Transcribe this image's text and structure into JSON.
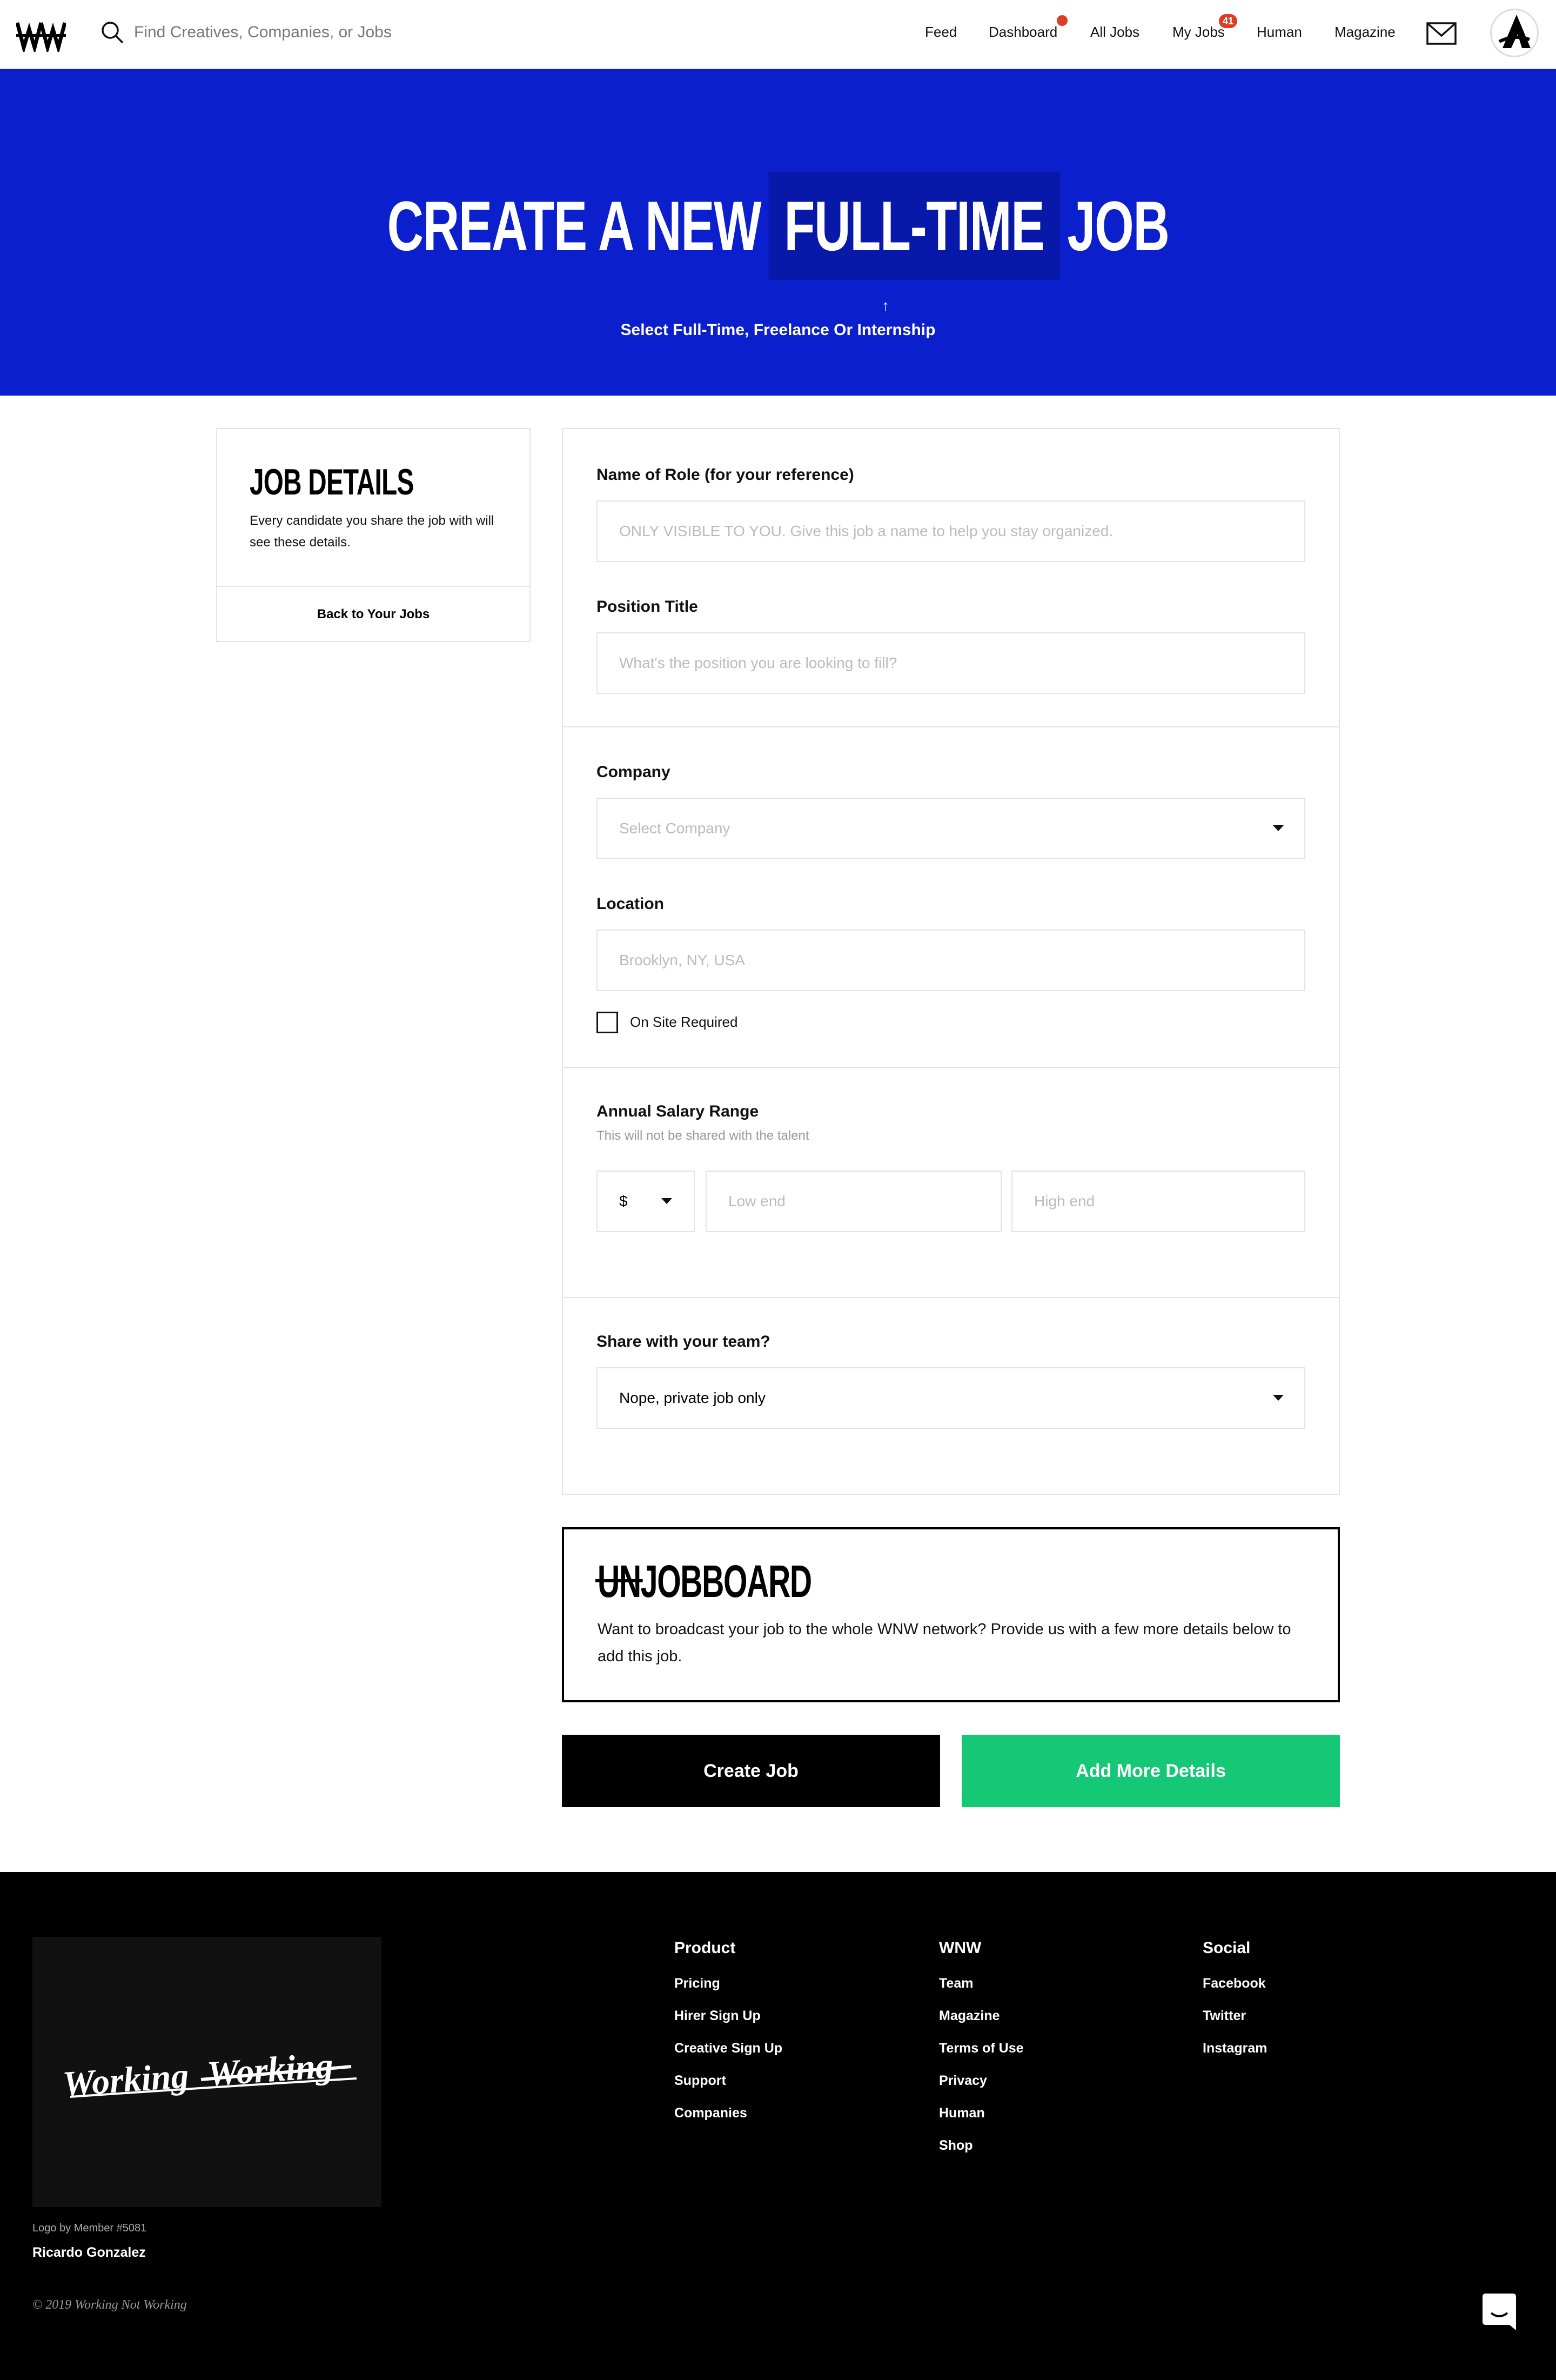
{
  "nav": {
    "search_placeholder": "Find Creatives, Companies, or Jobs",
    "links": [
      "Feed",
      "Dashboard",
      "All Jobs",
      "My Jobs",
      "Human",
      "Magazine"
    ],
    "my_jobs_count": "41"
  },
  "hero": {
    "title_prefix": "CREATE A NEW",
    "job_type": "FULL-TIME",
    "title_suffix": "JOB",
    "arrow": "↑",
    "subtitle": "Select Full-Time, Freelance Or Internship"
  },
  "sidebar": {
    "title": "JOB DETAILS",
    "description": "Every candidate you share the job with will see these details.",
    "back_link": "Back to Your Jobs"
  },
  "form": {
    "role_name": {
      "label": "Name of Role (for your reference)",
      "placeholder": "ONLY VISIBLE TO YOU. Give this job a name to help you stay organized."
    },
    "position_title": {
      "label": "Position Title",
      "placeholder": "What's the position you are looking to fill?"
    },
    "company": {
      "label": "Company",
      "selected": "Select Company"
    },
    "location": {
      "label": "Location",
      "placeholder": "Brooklyn, NY, USA"
    },
    "on_site": {
      "label": "On Site Required",
      "checked": false
    },
    "salary": {
      "label": "Annual Salary Range",
      "hint": "This will not be shared with the talent",
      "currency": "$",
      "low_placeholder": "Low end",
      "high_placeholder": "High end"
    },
    "share": {
      "label": "Share with your team?",
      "selected": "Nope, private job only"
    }
  },
  "unjobboard": {
    "logo_strike": "UN",
    "logo_rest": "JOBBOARD",
    "text": "Want to broadcast your job to the whole WNW network? Provide us with a few more details below to add this job."
  },
  "actions": {
    "create": "Create Job",
    "more": "Add More Details"
  },
  "colors": {
    "hero_blue": "#0b1fcc",
    "accent_green": "#14c875",
    "badge_red": "#e03b24"
  },
  "footer": {
    "logo_credit_label": "Logo by Member #5081",
    "logo_credit_name": "Ricardo Gonzalez",
    "copyright": "© 2019 Working Not Working",
    "art_words": [
      "Working",
      "Working"
    ],
    "columns": [
      {
        "title": "Product",
        "links": [
          "Pricing",
          "Hirer Sign Up",
          "Creative Sign Up",
          "Support",
          "Companies"
        ]
      },
      {
        "title": "WNW",
        "links": [
          "Team",
          "Magazine",
          "Terms of Use",
          "Privacy",
          "Human",
          "Shop"
        ]
      },
      {
        "title": "Social",
        "links": [
          "Facebook",
          "Twitter",
          "Instagram"
        ]
      }
    ]
  }
}
